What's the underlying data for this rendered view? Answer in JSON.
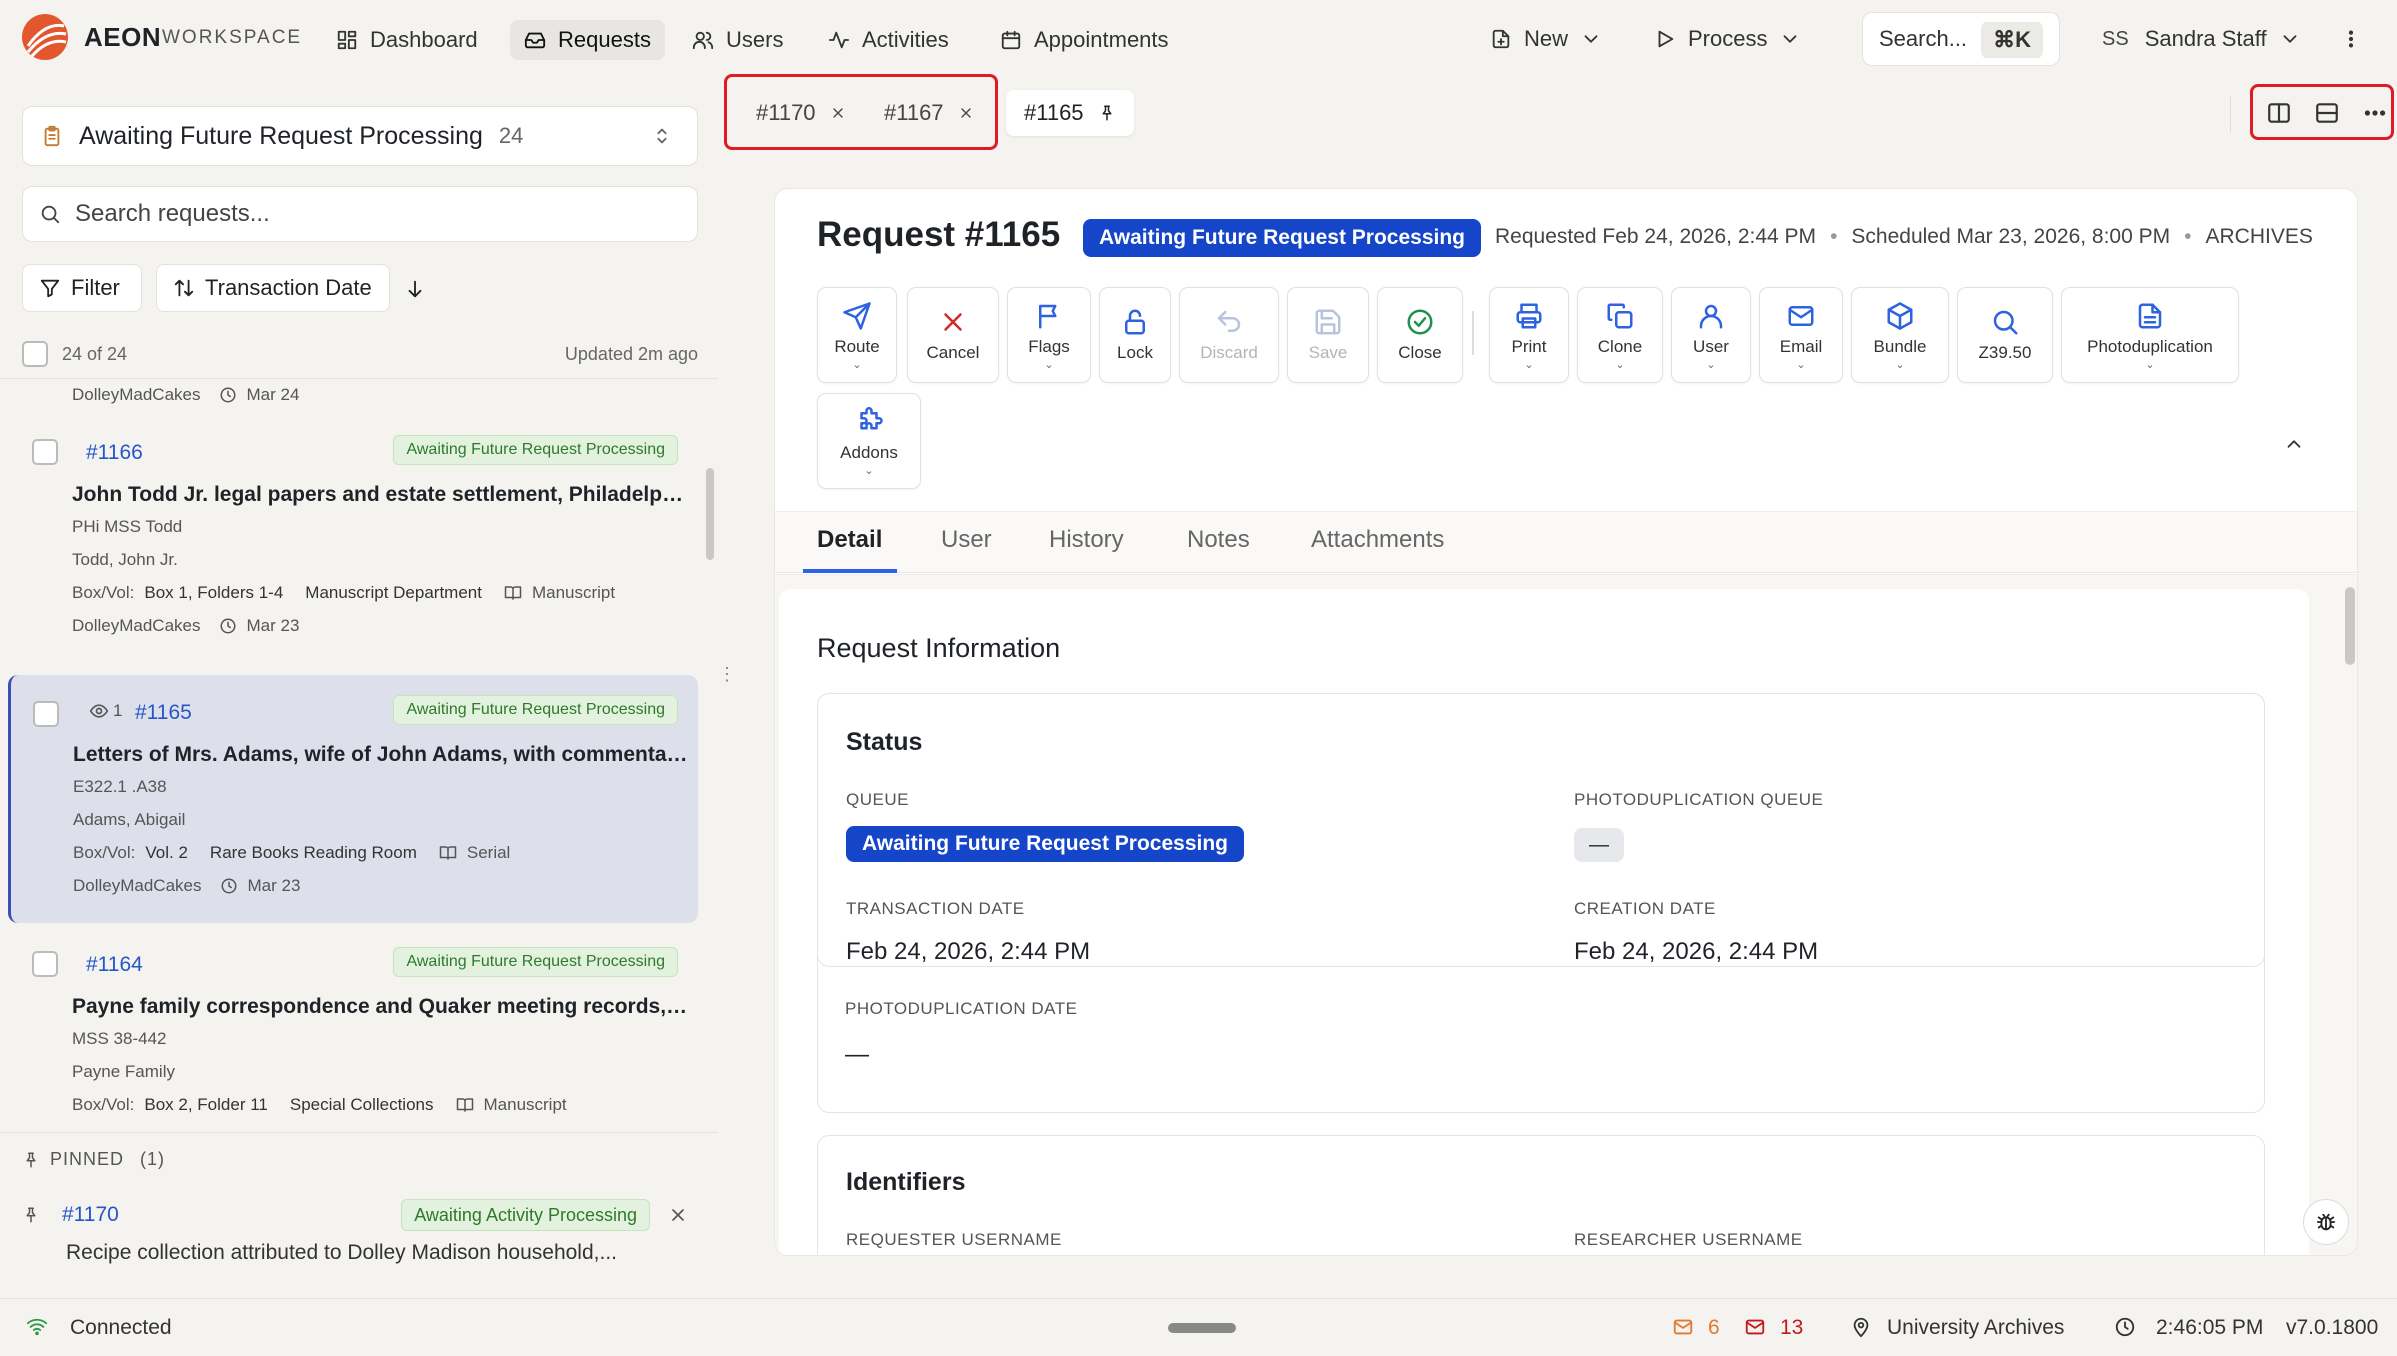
{
  "app": {
    "brand": "AEON",
    "brand_sub": "WORKSPACE"
  },
  "nav": [
    {
      "label": "Dashboard",
      "icon": "dashboard-icon"
    },
    {
      "label": "Requests",
      "icon": "inbox-icon",
      "active": true
    },
    {
      "label": "Users",
      "icon": "users-icon"
    },
    {
      "label": "Activities",
      "icon": "activity-icon"
    },
    {
      "label": "Appointments",
      "icon": "calendar-icon"
    }
  ],
  "header": {
    "new_label": "New",
    "process_label": "Process",
    "search_label": "Search...",
    "search_shortcut": "⌘K",
    "user_initials": "SS",
    "user_name": "Sandra Staff"
  },
  "left": {
    "queue_name": "Awaiting Future Request Processing",
    "queue_count": "24",
    "search_placeholder": "Search requests...",
    "filter_label": "Filter",
    "sort_label": "Transaction Date",
    "count_text": "24 of 24",
    "updated_text": "Updated 2m ago",
    "partial_top": {
      "owner": "DolleyMadCakes",
      "date": "Mar 24"
    },
    "requests": [
      {
        "id": "#1166",
        "status": "Awaiting Future Request Processing",
        "title": "John Todd Jr. legal papers and estate settlement, Philadelphia",
        "callnum": "PHi MSS Todd",
        "author": "Todd, John Jr.",
        "boxvol_label": "Box/Vol:",
        "boxvol": "Box 1, Folders 1-4",
        "location": "Manuscript Department",
        "format": "Manuscript",
        "owner": "DolleyMadCakes",
        "date": "Mar 23"
      },
      {
        "id": "#1165",
        "views": "1",
        "status": "Awaiting Future Request Processing",
        "title": "Letters of Mrs. Adams, wife of John Adams, with commentary...",
        "callnum": "E322.1 .A38",
        "author": "Adams, Abigail",
        "boxvol_label": "Box/Vol:",
        "boxvol": "Vol. 2",
        "location": "Rare Books Reading Room",
        "format": "Serial",
        "owner": "DolleyMadCakes",
        "date": "Mar 23"
      },
      {
        "id": "#1164",
        "status": "Awaiting Future Request Processing",
        "title": "Payne family correspondence and Quaker meeting records, H...",
        "callnum": "MSS 38-442",
        "author": "Payne Family",
        "boxvol_label": "Box/Vol:",
        "boxvol": "Box 2, Folder 11",
        "location": "Special Collections",
        "format": "Manuscript"
      }
    ],
    "pinned_label": "PINNED",
    "pinned_count": "(1)",
    "pinned_item": {
      "id": "#1170",
      "status": "Awaiting Activity Processing",
      "title": "Recipe collection attributed to Dolley Madison household,..."
    }
  },
  "tabs": [
    {
      "label": "#1170",
      "action": "close"
    },
    {
      "label": "#1167",
      "action": "close"
    },
    {
      "label": "#1165",
      "action": "pin",
      "active": true
    }
  ],
  "request": {
    "title": "Request #1165",
    "status_badge": "Awaiting Future Request Processing",
    "requested": "Requested Feb 24, 2026, 2:44 PM",
    "scheduled": "Scheduled Mar 23, 2026, 8:00 PM",
    "site": "ARCHIVES",
    "actions": [
      {
        "label": "Route",
        "icon": "send-icon",
        "menu": true
      },
      {
        "label": "Cancel",
        "icon": "x-icon"
      },
      {
        "label": "Flags",
        "icon": "flag-icon",
        "menu": true
      },
      {
        "label": "Lock",
        "icon": "lock-icon"
      },
      {
        "label": "Discard",
        "icon": "undo-icon",
        "disabled": true
      },
      {
        "label": "Save",
        "icon": "save-icon",
        "disabled": true
      },
      {
        "label": "Close",
        "icon": "check-circle-icon"
      },
      {
        "label": "Print",
        "icon": "printer-icon",
        "menu": true
      },
      {
        "label": "Clone",
        "icon": "copy-icon",
        "menu": true
      },
      {
        "label": "User",
        "icon": "user-icon",
        "menu": true
      },
      {
        "label": "Email",
        "icon": "mail-icon",
        "menu": true
      },
      {
        "label": "Bundle",
        "icon": "package-icon",
        "menu": true
      },
      {
        "label": "Z39.50",
        "icon": "search-icon"
      },
      {
        "label": "Photoduplication",
        "icon": "document-icon",
        "menu": true
      },
      {
        "label": "Addons",
        "icon": "puzzle-icon",
        "menu": true
      }
    ],
    "detail_tabs": [
      "Detail",
      "User",
      "History",
      "Notes",
      "Attachments"
    ],
    "section_title": "Request Information",
    "status_panel": {
      "title": "Status",
      "queue_label": "QUEUE",
      "queue_value": "Awaiting Future Request Processing",
      "photo_queue_label": "PHOTODUPLICATION QUEUE",
      "photo_queue_value": "—",
      "txn_label": "TRANSACTION DATE",
      "txn_value": "Feb 24, 2026, 2:44 PM",
      "creation_label": "CREATION DATE",
      "creation_value": "Feb 24, 2026, 2:44 PM",
      "photo_date_label": "PHOTODUPLICATION DATE",
      "photo_date_value": "—"
    },
    "identifiers_panel": {
      "title": "Identifiers",
      "requester_label": "REQUESTER USERNAME",
      "researcher_label": "RESEARCHER USERNAME"
    }
  },
  "status_bar": {
    "connection": "Connected",
    "mail_count_1": "6",
    "mail_count_2": "13",
    "site": "University Archives",
    "time": "2:46:05 PM",
    "version": "v7.0.1800"
  },
  "colors": {
    "accent": "#2d62e0",
    "badge_blue": "#1546c9",
    "badge_green_bg": "#e3f2df",
    "highlight_red": "#e01b24",
    "brand_orange": "#e4572e"
  }
}
